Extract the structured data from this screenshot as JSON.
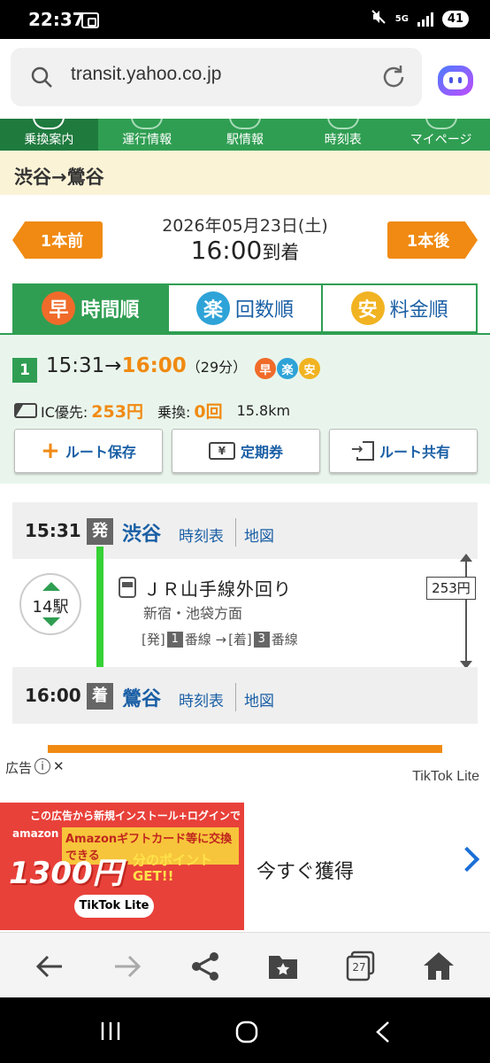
{
  "status_bar": {
    "time": "22:37",
    "network": "5G",
    "battery": "41"
  },
  "browser": {
    "url": "transit.yahoo.co.jp"
  },
  "nav_tabs": [
    {
      "label": "乗換案内",
      "active": true
    },
    {
      "label": "運行情報",
      "active": false
    },
    {
      "label": "駅情報",
      "active": false
    },
    {
      "label": "時刻表",
      "active": false
    },
    {
      "label": "マイページ",
      "active": false
    }
  ],
  "route_title": "渋谷→鶯谷",
  "date": {
    "prev_label": "1本前",
    "next_label": "1本後",
    "date_text": "2026年05月23日(土)",
    "time": "16:00",
    "time_suffix": "到着"
  },
  "sort_tabs": [
    {
      "badge": "早",
      "label": "時間順",
      "color": "#f06b2a"
    },
    {
      "badge": "楽",
      "label": "回数順",
      "color": "#2ea3d8"
    },
    {
      "badge": "安",
      "label": "料金順",
      "color": "#f1b321"
    }
  ],
  "summary": {
    "route_number": "1",
    "depart": "15:31",
    "arrow": "→",
    "arrive": "16:00",
    "duration": "（29分）",
    "badges": [
      {
        "text": "早",
        "color": "#f06b2a"
      },
      {
        "text": "楽",
        "color": "#2ea3d8"
      },
      {
        "text": "安",
        "color": "#f1b321"
      }
    ],
    "fare_label": "IC優先:",
    "fare": "253円",
    "transfer_label": "乗換:",
    "transfer": "0回",
    "distance": "15.8km",
    "buttons": {
      "save": "ルート保存",
      "pass": "定期券",
      "share": "ルート共有",
      "yen_icon": "¥"
    }
  },
  "detail": {
    "depart": {
      "time": "15:31",
      "badge": "発",
      "station": "渋谷",
      "link_timetable": "時刻表",
      "link_map": "地図"
    },
    "arrive": {
      "time": "16:00",
      "badge": "着",
      "station": "鶯谷",
      "link_timetable": "時刻表",
      "link_map": "地図"
    },
    "stops": "14駅",
    "line_name": "ＪＲ山手線外回り",
    "direction": "新宿・池袋方面",
    "platform_dep_label": "[発]",
    "platform_dep_num": "1",
    "platform_dep_suffix": "番線 →",
    "platform_arr_label": "[着]",
    "platform_arr_num": "3",
    "platform_arr_suffix": "番線",
    "fare": "253円"
  },
  "ad": {
    "label": "広告",
    "info": "i",
    "close": "✕",
    "sponsor": "TikTok Lite",
    "line1": "この広告から新規インストール+ログインで",
    "line2": "amazon",
    "line3": "Amazonギフトカード等に交換できる",
    "line4": "1300円",
    "line5": "分のポイント GET!!",
    "line6": "TikTok Lite",
    "cta": "今すぐ獲得"
  },
  "browser_bar": {
    "tabs_count": "27"
  },
  "colors": {
    "brand_green": "#2f9e52",
    "accent_orange": "#f08a12",
    "link_blue": "#1a5fa5",
    "line_green": "#35d135"
  }
}
